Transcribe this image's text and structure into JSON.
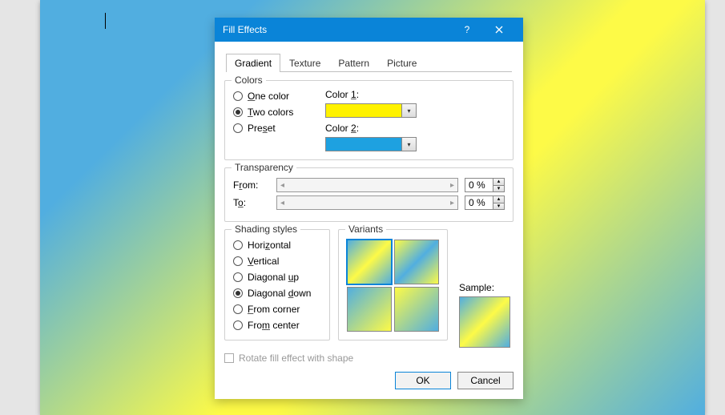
{
  "dialog": {
    "title": "Fill Effects",
    "tabs": [
      "Gradient",
      "Texture",
      "Pattern",
      "Picture"
    ],
    "active_tab": 0,
    "colors_group": "Colors",
    "color_options": {
      "one": "One color",
      "two": "Two colors",
      "preset": "Preset"
    },
    "color_selected": "two",
    "color1_label": "Color 1:",
    "color2_label": "Color 2:",
    "color1": "#fff200",
    "color2": "#1ea1e0",
    "transparency_group": "Transparency",
    "from_label": "From:",
    "to_label": "To:",
    "from_value": "0 %",
    "to_value": "0 %",
    "shading_group": "Shading styles",
    "shading_options": {
      "horizontal": "Horizontal",
      "vertical": "Vertical",
      "diag_up": "Diagonal up",
      "diag_down": "Diagonal down",
      "from_corner": "From corner",
      "from_center": "From center"
    },
    "shading_selected": "diag_down",
    "variants_label": "Variants",
    "sample_label": "Sample:",
    "rotate_label": "Rotate fill effect with shape",
    "ok_label": "OK",
    "cancel_label": "Cancel"
  }
}
